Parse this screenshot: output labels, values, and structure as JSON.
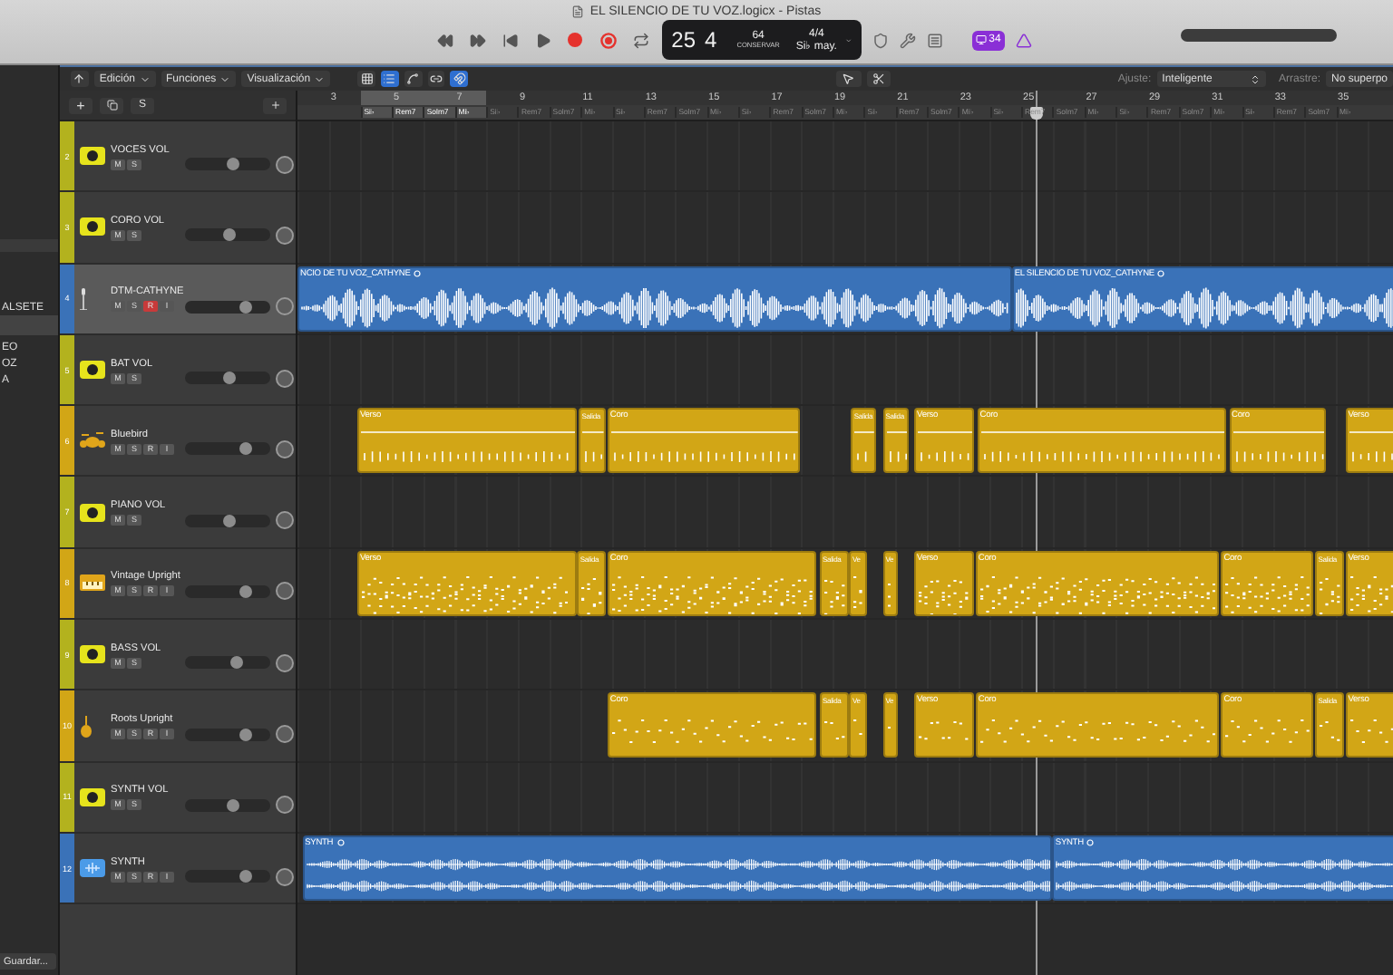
{
  "window": {
    "title": "EL SILENCIO DE TU VOZ.logicx - Pistas"
  },
  "transport": {
    "buttons": [
      {
        "kind": "rewind"
      },
      {
        "kind": "forward"
      },
      {
        "kind": "to-start"
      },
      {
        "kind": "play"
      },
      {
        "kind": "record"
      },
      {
        "kind": "capture"
      },
      {
        "kind": "cycle"
      }
    ]
  },
  "lcd": {
    "bar": "25",
    "beat": "4",
    "tempo": "64",
    "tempo_mode": "CONSERVAR",
    "signature": "4/4",
    "key": "Si♭ may."
  },
  "badge": {
    "text": "34"
  },
  "toolbar": {
    "menus": [
      "Edición",
      "Funciones",
      "Visualización"
    ],
    "snap_label": "Ajuste:",
    "snap_value": "Inteligente",
    "drag_label": "Arrastre:",
    "drag_value": "No superpo"
  },
  "sidebar": {
    "items": [
      {
        "text": "ALSETE",
        "selected": false
      },
      {
        "selected": true
      },
      {
        "text": "EO",
        "selected": false
      },
      {
        "text": "OZ",
        "selected": false
      },
      {
        "text": "A",
        "selected": false
      }
    ],
    "save_button": "Guardar..."
  },
  "ruler": {
    "numbers": [
      "3",
      "5",
      "7",
      "9",
      "11",
      "13",
      "15",
      "17",
      "19",
      "21",
      "23",
      "25",
      "27",
      "29",
      "31",
      "33",
      "35"
    ],
    "cycle": true,
    "chords": [
      "Si♭",
      "Rem7",
      "Solm7",
      "Mi♭",
      "Si♭",
      "Rem7",
      "Solm7",
      "Mi♭",
      "Si♭",
      "Rem7",
      "Solm7",
      "Mi♭",
      "Si♭",
      "Rem7",
      "Solm7",
      "Mi♭",
      "Si♭",
      "Rem7",
      "Solm7",
      "Mi♭",
      "Si♭",
      "Rem7",
      "Solm7",
      "Mi♭",
      "Si♭",
      "Rem7",
      "Solm7",
      "Mi♭",
      "Si♭",
      "Rem7",
      "Solm7",
      "Mi♭"
    ]
  },
  "header_buttons": {
    "add": "+",
    "solo": "S"
  },
  "tracks": [
    {
      "number": "2",
      "name": "VOCES VOL",
      "kind": "vca",
      "color": "#b3b21e",
      "selected": false,
      "level": 0.56,
      "buttons": [
        {
          "label": "M",
          "on": false
        },
        {
          "label": "S",
          "on": false
        }
      ]
    },
    {
      "number": "3",
      "name": "CORO VOL",
      "kind": "vca",
      "color": "#b3b21e",
      "selected": false,
      "level": 0.53,
      "buttons": [
        {
          "label": "M",
          "on": false
        },
        {
          "label": "S",
          "on": false
        }
      ]
    },
    {
      "number": "4",
      "name": "DTM-CATHYNE",
      "kind": "vocal",
      "color": "#3a72b8",
      "selected": true,
      "level": 0.72,
      "buttons": [
        {
          "label": "M",
          "on": false
        },
        {
          "label": "S",
          "on": false
        },
        {
          "label": "R",
          "on": true
        },
        {
          "label": "I",
          "on": false
        }
      ],
      "regions": [
        "NCIO DE TU VOZ_CATHYNE",
        "EL SILENCIO DE TU VOZ_CATHYNE"
      ]
    },
    {
      "number": "5",
      "name": "BAT VOL",
      "kind": "vca",
      "color": "#b3b21e",
      "selected": false,
      "level": 0.53,
      "buttons": [
        {
          "label": "M",
          "on": false
        },
        {
          "label": "S",
          "on": false
        }
      ]
    },
    {
      "number": "6",
      "name": "Bluebird",
      "kind": "drummer",
      "color": "#d2a616",
      "selected": false,
      "level": 0.72,
      "buttons": [
        {
          "label": "M",
          "on": false
        },
        {
          "label": "S",
          "on": false
        },
        {
          "label": "R",
          "on": false
        },
        {
          "label": "I",
          "on": false
        }
      ],
      "regions": [
        "Verso",
        "Salida",
        "Coro",
        "Salida",
        "Salida",
        "Verso",
        "Coro",
        "Coro",
        "Verso"
      ]
    },
    {
      "number": "7",
      "name": "PIANO VOL",
      "kind": "vca",
      "color": "#b3b21e",
      "selected": false,
      "level": 0.53,
      "buttons": [
        {
          "label": "M",
          "on": false
        },
        {
          "label": "S",
          "on": false
        }
      ]
    },
    {
      "number": "8",
      "name": "Vintage Upright",
      "kind": "keys",
      "color": "#d2a616",
      "selected": false,
      "level": 0.72,
      "buttons": [
        {
          "label": "M",
          "on": false
        },
        {
          "label": "S",
          "on": false
        },
        {
          "label": "R",
          "on": false
        },
        {
          "label": "I",
          "on": false
        }
      ],
      "regions": [
        "Verso",
        "Salida",
        "Coro",
        "Salida",
        "Ve",
        "Ve",
        "Verso",
        "Coro",
        "Coro",
        "Salida",
        "Verso"
      ]
    },
    {
      "number": "9",
      "name": "BASS VOL",
      "kind": "vca",
      "color": "#b3b21e",
      "selected": false,
      "level": 0.6,
      "buttons": [
        {
          "label": "M",
          "on": false
        },
        {
          "label": "S",
          "on": false
        }
      ]
    },
    {
      "number": "10",
      "name": "Roots Upright",
      "kind": "bass",
      "color": "#d2a616",
      "selected": false,
      "level": 0.72,
      "buttons": [
        {
          "label": "M",
          "on": false
        },
        {
          "label": "S",
          "on": false
        },
        {
          "label": "R",
          "on": false
        },
        {
          "label": "I",
          "on": false
        }
      ],
      "regions": [
        "Coro",
        "Salida",
        "Ve",
        "Ve",
        "Verso",
        "Coro",
        "Coro",
        "Salida",
        "Verso"
      ]
    },
    {
      "number": "11",
      "name": "SYNTH VOL",
      "kind": "vca",
      "color": "#b3b21e",
      "selected": false,
      "level": 0.56,
      "buttons": [
        {
          "label": "M",
          "on": false
        },
        {
          "label": "S",
          "on": false
        }
      ]
    },
    {
      "number": "12",
      "name": "SYNTH",
      "kind": "audio",
      "color": "#3a72b8",
      "selected": false,
      "level": 0.72,
      "buttons": [
        {
          "label": "M",
          "on": false
        },
        {
          "label": "S",
          "on": false
        },
        {
          "label": "R",
          "on": false
        },
        {
          "label": "I",
          "on": false
        }
      ],
      "regions": [
        "SYNTH",
        "SYNTH"
      ]
    }
  ]
}
